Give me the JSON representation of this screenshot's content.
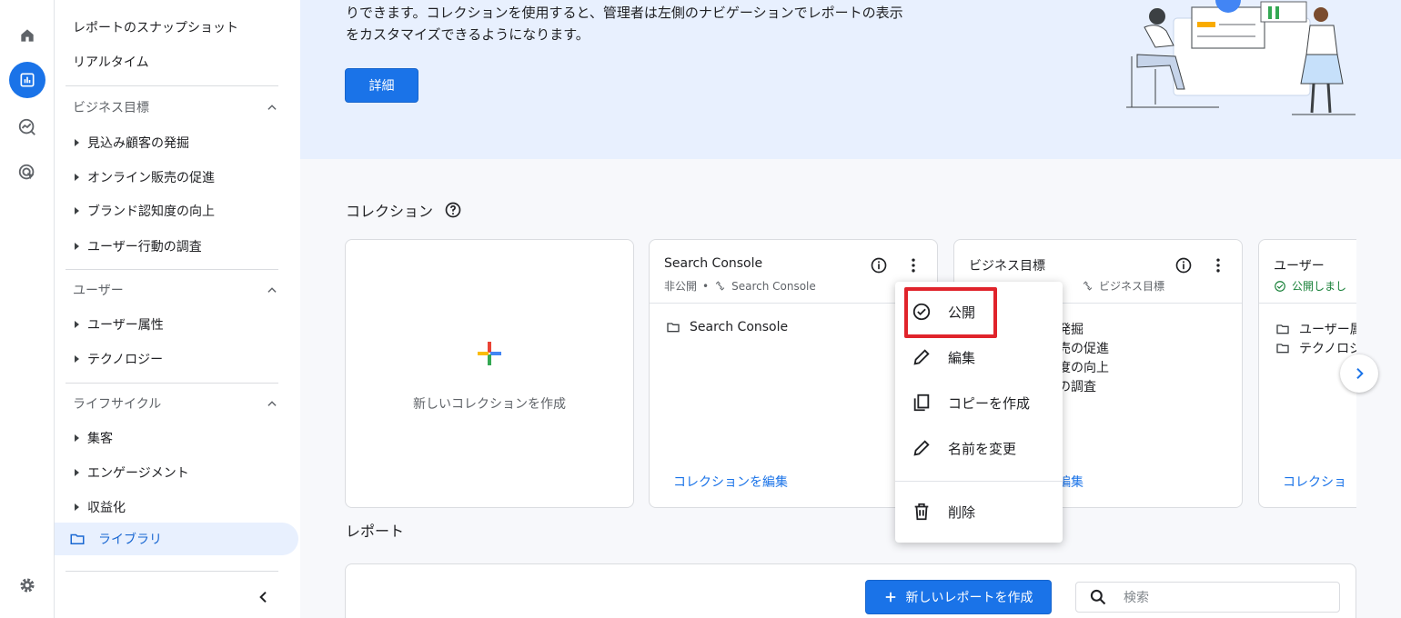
{
  "sidebar": {
    "top_items": [
      "レポートのスナップショット",
      "リアルタイム"
    ],
    "sections": [
      {
        "label": "ビジネス目標",
        "items": [
          "見込み顧客の発掘",
          "オンライン販売の促進",
          "ブランド認知度の向上",
          "ユーザー行動の調査"
        ]
      },
      {
        "label": "ユーザー",
        "items": [
          "ユーザー属性",
          "テクノロジー"
        ]
      },
      {
        "label": "ライフサイクル",
        "items": [
          "集客",
          "エンゲージメント",
          "収益化"
        ]
      }
    ],
    "library": "ライブラリ"
  },
  "banner": {
    "line1": "りできます。コレクションを使用すると、管理者は左側のナビゲーションでレポートの表示",
    "line2": "をカスタマイズできるようになります。",
    "button": "詳細"
  },
  "collections": {
    "title": "コレクション",
    "new_card": "新しいコレクションを作成",
    "cards": [
      {
        "title": "Search Console",
        "status": "非公開",
        "source": "Search Console",
        "rows": [
          "Search Console"
        ],
        "link": "コレクションを編集"
      },
      {
        "title": "ビジネス目標",
        "source": "ビジネス目標",
        "rows": [
          "の発掘",
          "販売の促進",
          "知度の向上",
          "動の調査"
        ],
        "link": "を編集"
      },
      {
        "title": "ユーザー",
        "status": "公開しまし",
        "rows": [
          "ユーザー属",
          "テクノロジ"
        ],
        "link": "コレクショ"
      }
    ]
  },
  "menu": {
    "items": [
      "公開",
      "編集",
      "コピーを作成",
      "名前を変更",
      "削除"
    ]
  },
  "reports": {
    "title": "レポート",
    "new_button": "新しいレポートを作成",
    "search_placeholder": "検索"
  },
  "colors": {
    "accent": "#1a73e8",
    "highlight": "#e0232b",
    "banner_bg": "#e8f0fe"
  }
}
